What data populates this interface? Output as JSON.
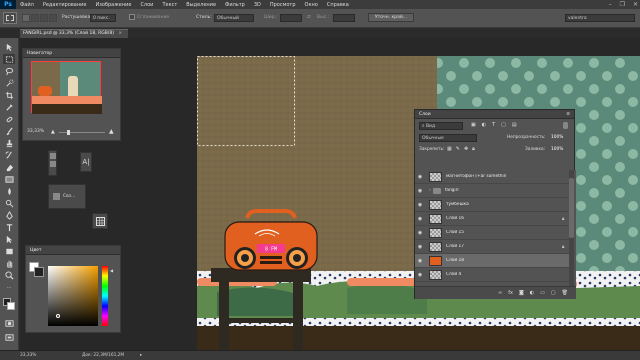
{
  "app": {
    "logo": "Ps"
  },
  "menu": [
    "Файл",
    "Редактирование",
    "Изображение",
    "Слои",
    "Текст",
    "Выделение",
    "Фильтр",
    "3D",
    "Просмотр",
    "Окно",
    "Справка"
  ],
  "options": {
    "feather_label": "Растушевка:",
    "feather_value": "0 пикс.",
    "antialias_label": "Сглаживание",
    "style_label": "Стиль:",
    "style_value": "Обычный",
    "width_label": "Шир.:",
    "height_label": "Выс.:",
    "refine_button": "Уточн. край...",
    "workspace_value": "valentra"
  },
  "document": {
    "tab_title": "FANGIRL.psd @ 33,3% (Слой 18, RGB/8)"
  },
  "navigator": {
    "title": "Навигатор",
    "zoom": "33,33%"
  },
  "minipanels": {
    "swatch_label": "Свз..."
  },
  "color": {
    "title": "Цвет"
  },
  "layers_panel": {
    "title": "Слои",
    "filter_value": "Вид",
    "blend_mode": "Обычные",
    "opacity_label": "Непрозрачность:",
    "opacity_value": "100%",
    "lock_label": "Закрепить:",
    "fill_label": "Заливка:",
    "fill_value": "100%",
    "layers": [
      {
        "name": "магнитофон [+ar somethin",
        "selected": false,
        "locked": false
      },
      {
        "name": "fangirl",
        "selected": false,
        "locked": false
      },
      {
        "name": "тумбешка",
        "selected": false,
        "locked": false
      },
      {
        "name": "Слой 16",
        "selected": false,
        "locked": true
      },
      {
        "name": "Слой 15",
        "selected": false,
        "locked": false
      },
      {
        "name": "Слой 17",
        "selected": false,
        "locked": true
      },
      {
        "name": "Слой 18",
        "selected": true,
        "locked": false
      },
      {
        "name": "Слой 4",
        "selected": false,
        "locked": false
      }
    ],
    "footer_icons": [
      "link-icon",
      "fx-icon",
      "mask-icon",
      "adjustment-icon",
      "folder-icon",
      "new-layer-icon",
      "trash-icon"
    ]
  },
  "radio": {
    "display": "8 FM"
  },
  "status": {
    "zoom": "33,33%",
    "doc_size": "Док: 22,3M/161,2M"
  },
  "colors": {
    "accent_ps": "#31a8ff",
    "ui_dark": "#535353",
    "radio_orange": "#e2601f",
    "wall_green": "#5b8a7a",
    "wall_brown": "#7a6a4a"
  }
}
